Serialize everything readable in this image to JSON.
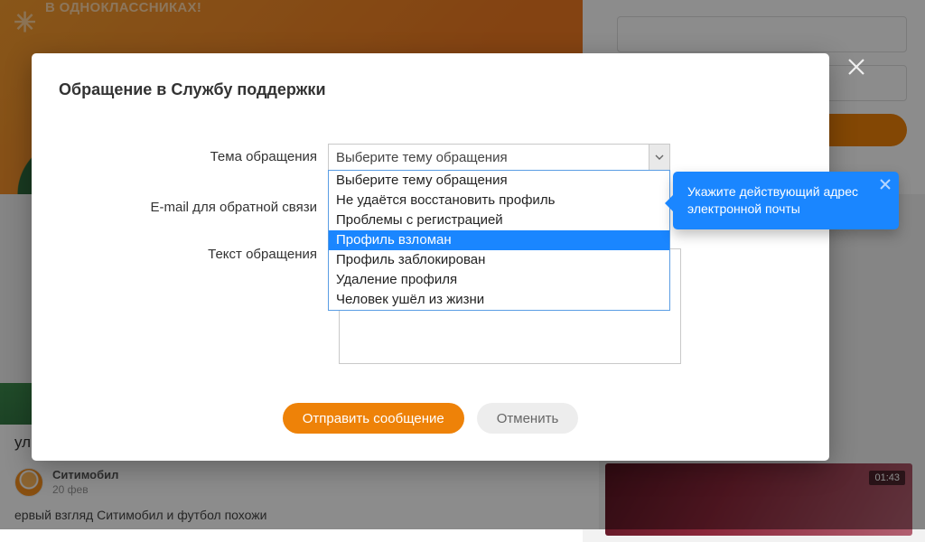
{
  "banner": {
    "tagline": "В ОДНОКЛАССНИКАХ!"
  },
  "feed": {
    "tab_label": "улг",
    "post": {
      "author": "Ситимобил",
      "date": "20 фев",
      "body": "ервый взгляд Ситимобил и футбол похожи"
    }
  },
  "video": {
    "duration": "01:43"
  },
  "modal": {
    "title": "Обращение в Службу поддержки",
    "labels": {
      "topic": "Тема обращения",
      "email": "E-mail для обратной связи",
      "body": "Текст обращения"
    },
    "select": {
      "current": "Выберите тему обращения",
      "options": [
        "Выберите тему обращения",
        "Не удаётся восстановить профиль",
        "Проблемы с регистрацией",
        "Профиль взломан",
        "Профиль заблокирован",
        "Удаление профиля",
        "Человек ушёл из жизни"
      ],
      "hover_index": 3
    },
    "buttons": {
      "submit": "Отправить сообщение",
      "cancel": "Отменить"
    }
  },
  "tooltip": {
    "text": "Укажите действующий адрес электронной почты"
  }
}
